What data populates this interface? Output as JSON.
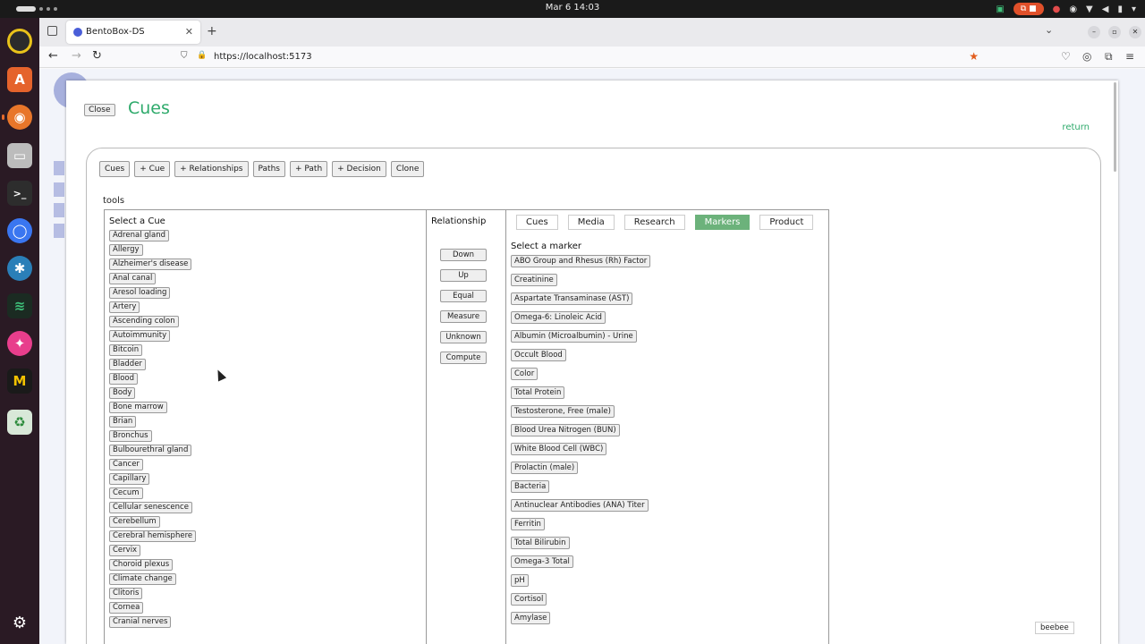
{
  "system": {
    "clock": "Mar 6  14:03"
  },
  "browser": {
    "tab_title": "BentoBox-DS",
    "url": "https://localhost:5173"
  },
  "modal": {
    "close_label": "Close",
    "title": "Cues",
    "return_label": "return"
  },
  "toolbar": {
    "buttons": [
      "Cues",
      "+ Cue",
      "+ Relationships",
      "Paths",
      "+ Path",
      "+ Decision",
      "Clone"
    ]
  },
  "tools_label": "tools",
  "cues_panel": {
    "heading": "Select a Cue",
    "items": [
      "Adrenal gland",
      "Allergy",
      "Alzheimer's disease",
      "Anal canal",
      "Aresol loading",
      "Artery",
      "Ascending colon",
      "Autoimmunity",
      "Bitcoin",
      "Bladder",
      "Blood",
      "Body",
      "Bone marrow",
      "Brian",
      "Bronchus",
      "Bulbourethral gland",
      "Cancer",
      "Capillary",
      "Cecum",
      "Cellular senescence",
      "Cerebellum",
      "Cerebral hemisphere",
      "Cervix",
      "Choroid plexus",
      "Climate change",
      "Clitoris",
      "Cornea",
      "Cranial nerves"
    ]
  },
  "relationship_panel": {
    "heading": "Relationship",
    "buttons": [
      "Down",
      "Up",
      "Equal",
      "Measure",
      "Unknown",
      "Compute"
    ]
  },
  "markers_panel": {
    "tabs": [
      "Cues",
      "Media",
      "Research",
      "Markers",
      "Product"
    ],
    "active_tab": "Markers",
    "active_color": "#6cb27b",
    "heading": "Select a marker",
    "items": [
      "ABO Group and Rhesus (Rh) Factor",
      "Creatinine",
      "Aspartate Transaminase (AST)",
      "Omega-6: Linoleic Acid",
      "Albumin (Microalbumin) - Urine",
      "Occult Blood",
      "Color",
      "Total Protein",
      "Testosterone, Free (male)",
      "Blood Urea Nitrogen (BUN)",
      "White Blood Cell (WBC)",
      "Prolactin (male)",
      "Bacteria",
      "Antinuclear Antibodies (ANA) Titer",
      "Ferritin",
      "Total Bilirubin",
      "Omega-3 Total",
      "pH",
      "Cortisol",
      "Amylase"
    ]
  },
  "beebee_label": "beebee",
  "accent_color": "#2eaa6b"
}
